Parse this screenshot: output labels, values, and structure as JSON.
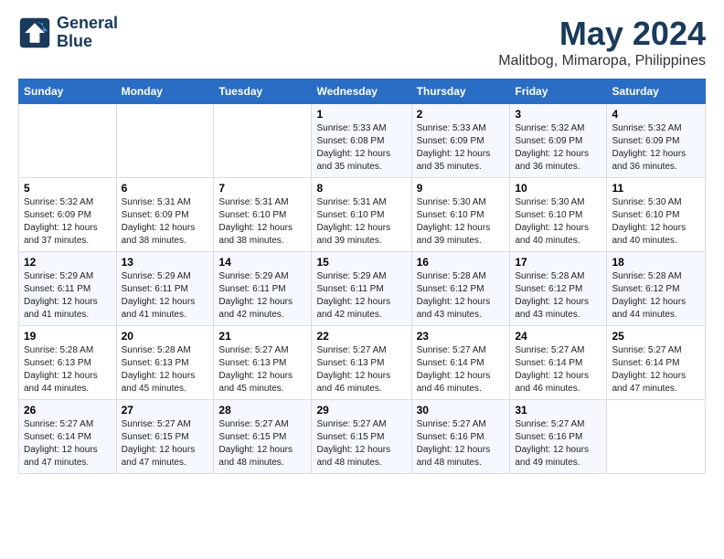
{
  "logo": {
    "line1": "General",
    "line2": "Blue"
  },
  "title": "May 2024",
  "subtitle": "Malitbog, Mimaropa, Philippines",
  "days_of_week": [
    "Sunday",
    "Monday",
    "Tuesday",
    "Wednesday",
    "Thursday",
    "Friday",
    "Saturday"
  ],
  "weeks": [
    [
      {
        "day": "",
        "info": ""
      },
      {
        "day": "",
        "info": ""
      },
      {
        "day": "",
        "info": ""
      },
      {
        "day": "1",
        "info": "Sunrise: 5:33 AM\nSunset: 6:08 PM\nDaylight: 12 hours\nand 35 minutes."
      },
      {
        "day": "2",
        "info": "Sunrise: 5:33 AM\nSunset: 6:09 PM\nDaylight: 12 hours\nand 35 minutes."
      },
      {
        "day": "3",
        "info": "Sunrise: 5:32 AM\nSunset: 6:09 PM\nDaylight: 12 hours\nand 36 minutes."
      },
      {
        "day": "4",
        "info": "Sunrise: 5:32 AM\nSunset: 6:09 PM\nDaylight: 12 hours\nand 36 minutes."
      }
    ],
    [
      {
        "day": "5",
        "info": "Sunrise: 5:32 AM\nSunset: 6:09 PM\nDaylight: 12 hours\nand 37 minutes."
      },
      {
        "day": "6",
        "info": "Sunrise: 5:31 AM\nSunset: 6:09 PM\nDaylight: 12 hours\nand 38 minutes."
      },
      {
        "day": "7",
        "info": "Sunrise: 5:31 AM\nSunset: 6:10 PM\nDaylight: 12 hours\nand 38 minutes."
      },
      {
        "day": "8",
        "info": "Sunrise: 5:31 AM\nSunset: 6:10 PM\nDaylight: 12 hours\nand 39 minutes."
      },
      {
        "day": "9",
        "info": "Sunrise: 5:30 AM\nSunset: 6:10 PM\nDaylight: 12 hours\nand 39 minutes."
      },
      {
        "day": "10",
        "info": "Sunrise: 5:30 AM\nSunset: 6:10 PM\nDaylight: 12 hours\nand 40 minutes."
      },
      {
        "day": "11",
        "info": "Sunrise: 5:30 AM\nSunset: 6:10 PM\nDaylight: 12 hours\nand 40 minutes."
      }
    ],
    [
      {
        "day": "12",
        "info": "Sunrise: 5:29 AM\nSunset: 6:11 PM\nDaylight: 12 hours\nand 41 minutes."
      },
      {
        "day": "13",
        "info": "Sunrise: 5:29 AM\nSunset: 6:11 PM\nDaylight: 12 hours\nand 41 minutes."
      },
      {
        "day": "14",
        "info": "Sunrise: 5:29 AM\nSunset: 6:11 PM\nDaylight: 12 hours\nand 42 minutes."
      },
      {
        "day": "15",
        "info": "Sunrise: 5:29 AM\nSunset: 6:11 PM\nDaylight: 12 hours\nand 42 minutes."
      },
      {
        "day": "16",
        "info": "Sunrise: 5:28 AM\nSunset: 6:12 PM\nDaylight: 12 hours\nand 43 minutes."
      },
      {
        "day": "17",
        "info": "Sunrise: 5:28 AM\nSunset: 6:12 PM\nDaylight: 12 hours\nand 43 minutes."
      },
      {
        "day": "18",
        "info": "Sunrise: 5:28 AM\nSunset: 6:12 PM\nDaylight: 12 hours\nand 44 minutes."
      }
    ],
    [
      {
        "day": "19",
        "info": "Sunrise: 5:28 AM\nSunset: 6:13 PM\nDaylight: 12 hours\nand 44 minutes."
      },
      {
        "day": "20",
        "info": "Sunrise: 5:28 AM\nSunset: 6:13 PM\nDaylight: 12 hours\nand 45 minutes."
      },
      {
        "day": "21",
        "info": "Sunrise: 5:27 AM\nSunset: 6:13 PM\nDaylight: 12 hours\nand 45 minutes."
      },
      {
        "day": "22",
        "info": "Sunrise: 5:27 AM\nSunset: 6:13 PM\nDaylight: 12 hours\nand 46 minutes."
      },
      {
        "day": "23",
        "info": "Sunrise: 5:27 AM\nSunset: 6:14 PM\nDaylight: 12 hours\nand 46 minutes."
      },
      {
        "day": "24",
        "info": "Sunrise: 5:27 AM\nSunset: 6:14 PM\nDaylight: 12 hours\nand 46 minutes."
      },
      {
        "day": "25",
        "info": "Sunrise: 5:27 AM\nSunset: 6:14 PM\nDaylight: 12 hours\nand 47 minutes."
      }
    ],
    [
      {
        "day": "26",
        "info": "Sunrise: 5:27 AM\nSunset: 6:14 PM\nDaylight: 12 hours\nand 47 minutes."
      },
      {
        "day": "27",
        "info": "Sunrise: 5:27 AM\nSunset: 6:15 PM\nDaylight: 12 hours\nand 47 minutes."
      },
      {
        "day": "28",
        "info": "Sunrise: 5:27 AM\nSunset: 6:15 PM\nDaylight: 12 hours\nand 48 minutes."
      },
      {
        "day": "29",
        "info": "Sunrise: 5:27 AM\nSunset: 6:15 PM\nDaylight: 12 hours\nand 48 minutes."
      },
      {
        "day": "30",
        "info": "Sunrise: 5:27 AM\nSunset: 6:16 PM\nDaylight: 12 hours\nand 48 minutes."
      },
      {
        "day": "31",
        "info": "Sunrise: 5:27 AM\nSunset: 6:16 PM\nDaylight: 12 hours\nand 49 minutes."
      },
      {
        "day": "",
        "info": ""
      }
    ]
  ]
}
